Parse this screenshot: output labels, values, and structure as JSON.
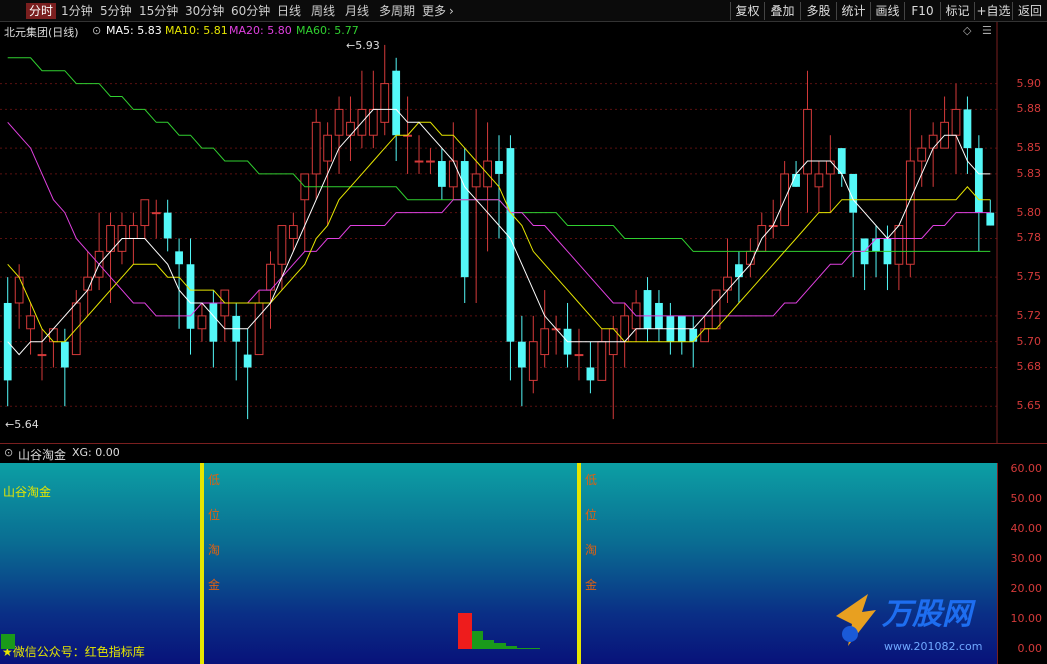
{
  "toolbar": {
    "periods": [
      "分时",
      "1分钟",
      "5分钟",
      "15分钟",
      "30分钟",
      "60分钟",
      "日线",
      "周线",
      "月线",
      "多周期",
      "更多"
    ],
    "buttons": [
      "复权",
      "叠加",
      "多股",
      "统计",
      "画线",
      "F10",
      "标记",
      "+自选",
      "返回"
    ]
  },
  "main_chart": {
    "title": "北元集团(日线)",
    "ma5": "MA5: 5.83",
    "ma10": "MA10: 5.81",
    "ma20": "MA20: 5.80",
    "ma60": "MA60: 5.77",
    "high_label": "5.93",
    "low_label": "5.64",
    "diamond": "◇",
    "menu": "☰"
  },
  "colors": {
    "up": "#d43a3a",
    "down": "#54f8f8",
    "ma5": "#ffffff",
    "ma10": "#e6e600",
    "ma20": "#e040e0",
    "ma60": "#30d030"
  },
  "indicator": {
    "name": "山谷淘金",
    "xg": "XG: 0.00",
    "label": "山谷淘金",
    "signal_chars": [
      "低",
      "位",
      "淘",
      "金"
    ],
    "footer_text": "★微信公众号：红色指标库",
    "watermark": "万股网",
    "watermark_url": "www.201082.com"
  },
  "chart_data": [
    {
      "type": "candlestick",
      "title": "北元集团(日线)",
      "ylim": [
        5.63,
        5.94
      ],
      "y_ticks": [
        "5.90",
        "5.88",
        "5.85",
        "5.83",
        "5.80",
        "5.78",
        "5.75",
        "5.72",
        "5.70",
        "5.68",
        "5.65"
      ],
      "y_values": [
        5.9,
        5.88,
        5.85,
        5.83,
        5.8,
        5.78,
        5.75,
        5.72,
        5.7,
        5.68,
        5.65
      ],
      "candles": [
        [
          5.73,
          5.67,
          5.75,
          5.65
        ],
        [
          5.73,
          5.75,
          5.76,
          5.71
        ],
        [
          5.71,
          5.72,
          5.73,
          5.69
        ],
        [
          5.69,
          5.69,
          5.71,
          5.67
        ],
        [
          5.7,
          5.71,
          5.71,
          5.68
        ],
        [
          5.7,
          5.68,
          5.71,
          5.65
        ],
        [
          5.69,
          5.73,
          5.74,
          5.69
        ],
        [
          5.74,
          5.75,
          5.77,
          5.72
        ],
        [
          5.75,
          5.77,
          5.8,
          5.74
        ],
        [
          5.77,
          5.79,
          5.8,
          5.73
        ],
        [
          5.77,
          5.79,
          5.8,
          5.76
        ],
        [
          5.78,
          5.79,
          5.8,
          5.76
        ],
        [
          5.79,
          5.81,
          5.81,
          5.78
        ],
        [
          5.8,
          5.8,
          5.81,
          5.78
        ],
        [
          5.8,
          5.78,
          5.81,
          5.77
        ],
        [
          5.77,
          5.76,
          5.78,
          5.71
        ],
        [
          5.76,
          5.71,
          5.78,
          5.69
        ],
        [
          5.71,
          5.72,
          5.73,
          5.7
        ],
        [
          5.73,
          5.7,
          5.74,
          5.68
        ],
        [
          5.72,
          5.74,
          5.74,
          5.7
        ],
        [
          5.72,
          5.7,
          5.73,
          5.67
        ],
        [
          5.69,
          5.68,
          5.71,
          5.64
        ],
        [
          5.69,
          5.73,
          5.74,
          5.69
        ],
        [
          5.74,
          5.76,
          5.77,
          5.71
        ],
        [
          5.76,
          5.79,
          5.79,
          5.74
        ],
        [
          5.78,
          5.79,
          5.8,
          5.77
        ],
        [
          5.81,
          5.83,
          5.83,
          5.77
        ],
        [
          5.83,
          5.87,
          5.88,
          5.81
        ],
        [
          5.84,
          5.86,
          5.87,
          5.79
        ],
        [
          5.86,
          5.88,
          5.89,
          5.83
        ],
        [
          5.86,
          5.87,
          5.89,
          5.84
        ],
        [
          5.86,
          5.88,
          5.91,
          5.85
        ],
        [
          5.86,
          5.88,
          5.91,
          5.85
        ],
        [
          5.87,
          5.9,
          5.93,
          5.86
        ],
        [
          5.91,
          5.86,
          5.92,
          5.84
        ],
        [
          5.86,
          5.86,
          5.89,
          5.83
        ],
        [
          5.84,
          5.84,
          5.86,
          5.83
        ],
        [
          5.84,
          5.84,
          5.85,
          5.83
        ],
        [
          5.84,
          5.82,
          5.85,
          5.81
        ],
        [
          5.82,
          5.84,
          5.87,
          5.81
        ],
        [
          5.84,
          5.75,
          5.85,
          5.73
        ],
        [
          5.82,
          5.83,
          5.88,
          5.73
        ],
        [
          5.82,
          5.84,
          5.87,
          5.77
        ],
        [
          5.84,
          5.83,
          5.86,
          5.78
        ],
        [
          5.85,
          5.7,
          5.86,
          5.67
        ],
        [
          5.7,
          5.68,
          5.72,
          5.65
        ],
        [
          5.67,
          5.7,
          5.72,
          5.66
        ],
        [
          5.69,
          5.71,
          5.74,
          5.68
        ],
        [
          5.71,
          5.71,
          5.72,
          5.69
        ],
        [
          5.71,
          5.69,
          5.73,
          5.68
        ],
        [
          5.69,
          5.69,
          5.71,
          5.67
        ],
        [
          5.68,
          5.67,
          5.7,
          5.66
        ],
        [
          5.67,
          5.7,
          5.71,
          5.67
        ],
        [
          5.69,
          5.71,
          5.72,
          5.64
        ],
        [
          5.7,
          5.72,
          5.73,
          5.68
        ],
        [
          5.71,
          5.73,
          5.74,
          5.7
        ],
        [
          5.74,
          5.71,
          5.75,
          5.7
        ],
        [
          5.73,
          5.71,
          5.74,
          5.7
        ],
        [
          5.72,
          5.7,
          5.73,
          5.69
        ],
        [
          5.72,
          5.7,
          5.72,
          5.69
        ],
        [
          5.71,
          5.7,
          5.72,
          5.68
        ],
        [
          5.7,
          5.71,
          5.72,
          5.7
        ],
        [
          5.71,
          5.74,
          5.74,
          5.71
        ],
        [
          5.74,
          5.75,
          5.78,
          5.73
        ],
        [
          5.76,
          5.75,
          5.77,
          5.73
        ],
        [
          5.76,
          5.77,
          5.78,
          5.75
        ],
        [
          5.77,
          5.79,
          5.8,
          5.77
        ],
        [
          5.79,
          5.79,
          5.81,
          5.78
        ],
        [
          5.79,
          5.83,
          5.84,
          5.79
        ],
        [
          5.83,
          5.82,
          5.84,
          5.82
        ],
        [
          5.83,
          5.88,
          5.91,
          5.8
        ],
        [
          5.82,
          5.83,
          5.84,
          5.8
        ],
        [
          5.83,
          5.84,
          5.86,
          5.8
        ],
        [
          5.85,
          5.83,
          5.85,
          5.82
        ],
        [
          5.83,
          5.8,
          5.83,
          5.75
        ],
        [
          5.78,
          5.76,
          5.78,
          5.74
        ],
        [
          5.78,
          5.77,
          5.79,
          5.75
        ],
        [
          5.78,
          5.76,
          5.79,
          5.74
        ],
        [
          5.76,
          5.79,
          5.79,
          5.74
        ],
        [
          5.76,
          5.84,
          5.88,
          5.75
        ],
        [
          5.84,
          5.85,
          5.86,
          5.82
        ],
        [
          5.85,
          5.86,
          5.87,
          5.82
        ],
        [
          5.85,
          5.87,
          5.89,
          5.85
        ],
        [
          5.86,
          5.88,
          5.9,
          5.83
        ],
        [
          5.88,
          5.85,
          5.89,
          5.83
        ],
        [
          5.85,
          5.8,
          5.86,
          5.77
        ],
        [
          5.8,
          5.79,
          5.81,
          5.79
        ]
      ],
      "ma5": [
        5.7,
        5.69,
        5.7,
        5.7,
        5.71,
        5.72,
        5.73,
        5.74,
        5.76,
        5.77,
        5.78,
        5.78,
        5.78,
        5.77,
        5.76,
        5.74,
        5.73,
        5.73,
        5.72,
        5.71,
        5.71,
        5.71,
        5.72,
        5.73,
        5.75,
        5.77,
        5.79,
        5.81,
        5.83,
        5.85,
        5.86,
        5.87,
        5.88,
        5.88,
        5.88,
        5.87,
        5.87,
        5.86,
        5.85,
        5.84,
        5.82,
        5.81,
        5.8,
        5.79,
        5.78,
        5.76,
        5.74,
        5.72,
        5.71,
        5.7,
        5.7,
        5.7,
        5.7,
        5.7,
        5.7,
        5.71,
        5.71,
        5.71,
        5.71,
        5.71,
        5.71,
        5.72,
        5.73,
        5.74,
        5.75,
        5.76,
        5.78,
        5.79,
        5.81,
        5.83,
        5.84,
        5.84,
        5.84,
        5.83,
        5.81,
        5.8,
        5.79,
        5.78,
        5.79,
        5.81,
        5.83,
        5.85,
        5.86,
        5.86,
        5.84,
        5.83,
        5.83
      ],
      "ma10": [
        5.76,
        5.75,
        5.73,
        5.71,
        5.7,
        5.7,
        5.71,
        5.72,
        5.73,
        5.74,
        5.75,
        5.76,
        5.76,
        5.76,
        5.75,
        5.75,
        5.74,
        5.74,
        5.74,
        5.73,
        5.73,
        5.73,
        5.73,
        5.73,
        5.74,
        5.75,
        5.76,
        5.78,
        5.79,
        5.81,
        5.82,
        5.83,
        5.84,
        5.85,
        5.86,
        5.86,
        5.87,
        5.87,
        5.86,
        5.86,
        5.85,
        5.84,
        5.83,
        5.82,
        5.8,
        5.79,
        5.77,
        5.76,
        5.75,
        5.74,
        5.73,
        5.72,
        5.71,
        5.71,
        5.7,
        5.7,
        5.7,
        5.7,
        5.7,
        5.7,
        5.7,
        5.71,
        5.71,
        5.72,
        5.73,
        5.74,
        5.75,
        5.76,
        5.77,
        5.78,
        5.79,
        5.8,
        5.8,
        5.81,
        5.81,
        5.81,
        5.81,
        5.81,
        5.81,
        5.81,
        5.81,
        5.81,
        5.81,
        5.81,
        5.82,
        5.81,
        5.81
      ],
      "ma20": [
        5.87,
        5.86,
        5.85,
        5.83,
        5.81,
        5.8,
        5.78,
        5.77,
        5.76,
        5.75,
        5.74,
        5.73,
        5.73,
        5.72,
        5.72,
        5.72,
        5.72,
        5.73,
        5.73,
        5.73,
        5.73,
        5.73,
        5.74,
        5.74,
        5.75,
        5.76,
        5.77,
        5.77,
        5.78,
        5.78,
        5.79,
        5.79,
        5.79,
        5.79,
        5.8,
        5.8,
        5.8,
        5.8,
        5.8,
        5.81,
        5.81,
        5.81,
        5.81,
        5.81,
        5.8,
        5.8,
        5.79,
        5.79,
        5.78,
        5.77,
        5.76,
        5.75,
        5.74,
        5.73,
        5.73,
        5.72,
        5.72,
        5.72,
        5.72,
        5.72,
        5.72,
        5.72,
        5.72,
        5.72,
        5.72,
        5.72,
        5.72,
        5.72,
        5.73,
        5.73,
        5.74,
        5.75,
        5.76,
        5.76,
        5.77,
        5.77,
        5.78,
        5.78,
        5.78,
        5.78,
        5.78,
        5.79,
        5.79,
        5.8,
        5.8,
        5.8,
        5.8
      ],
      "ma60": [
        5.92,
        5.92,
        5.92,
        5.91,
        5.91,
        5.91,
        5.9,
        5.9,
        5.9,
        5.89,
        5.89,
        5.88,
        5.88,
        5.87,
        5.87,
        5.86,
        5.86,
        5.85,
        5.85,
        5.84,
        5.84,
        5.84,
        5.83,
        5.83,
        5.83,
        5.83,
        5.82,
        5.82,
        5.82,
        5.82,
        5.82,
        5.82,
        5.82,
        5.82,
        5.82,
        5.81,
        5.81,
        5.81,
        5.81,
        5.81,
        5.81,
        5.81,
        5.81,
        5.81,
        5.8,
        5.8,
        5.8,
        5.8,
        5.8,
        5.79,
        5.79,
        5.79,
        5.79,
        5.79,
        5.78,
        5.78,
        5.78,
        5.78,
        5.78,
        5.78,
        5.77,
        5.77,
        5.77,
        5.77,
        5.77,
        5.77,
        5.77,
        5.77,
        5.77,
        5.77,
        5.77,
        5.77,
        5.77,
        5.77,
        5.77,
        5.77,
        5.77,
        5.77,
        5.77,
        5.77,
        5.77,
        5.77,
        5.77,
        5.77,
        5.77,
        5.77,
        5.77
      ]
    },
    {
      "type": "bar",
      "title": "山谷淘金",
      "ylim": [
        -5,
        62
      ],
      "y_ticks": [
        "60.00",
        "50.00",
        "40.00",
        "30.00",
        "20.00",
        "10.00",
        "0.00"
      ],
      "y_values": [
        60,
        50,
        40,
        30,
        20,
        10,
        0
      ],
      "signal_candles": [
        17,
        50
      ],
      "bars_red": [
        {
          "x": 40,
          "value": 12
        }
      ],
      "bars_green": [
        {
          "x": 0,
          "value": 5
        },
        {
          "x": 41,
          "value": 6
        },
        {
          "x": 42,
          "value": 3
        },
        {
          "x": 43,
          "value": 2
        },
        {
          "x": 44,
          "value": 1
        },
        {
          "x": 45,
          "value": 0.5
        },
        {
          "x": 46,
          "value": 0.3
        }
      ]
    }
  ]
}
